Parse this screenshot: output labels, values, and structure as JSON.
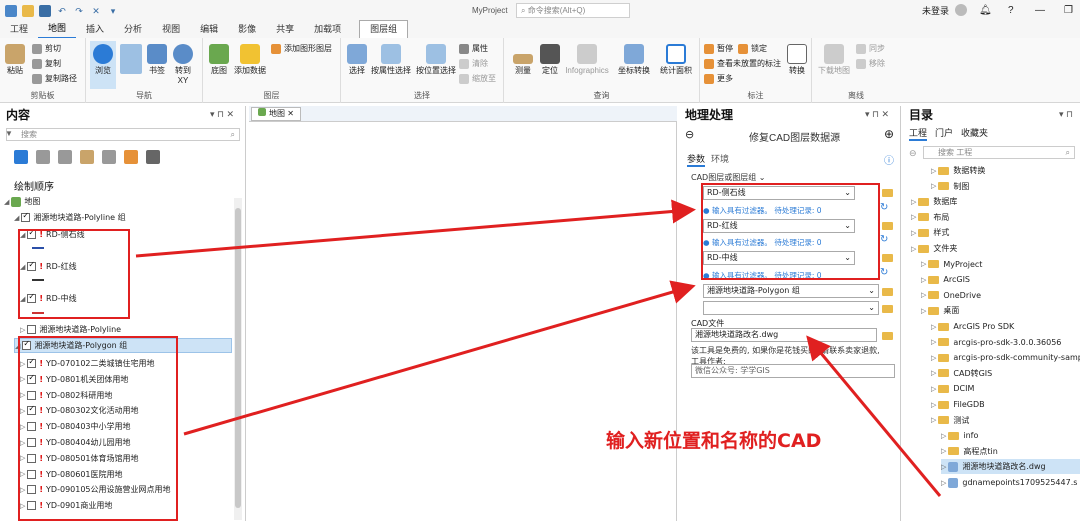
{
  "titlebar": {
    "project": "MyProject",
    "search_placeholder": "命令搜索(Alt+Q)",
    "login": "未登录",
    "help": "?"
  },
  "menu": {
    "tabs": [
      "工程",
      "地图",
      "插入",
      "分析",
      "视图",
      "编辑",
      "影像",
      "共享",
      "加载项"
    ],
    "context_tab": "图层组"
  },
  "ribbon": {
    "clipboard": {
      "paste": "粘贴",
      "cut": "剪切",
      "copy": "复制",
      "copy_path": "复制路径",
      "label": "剪贴板"
    },
    "navigate": {
      "explore": "浏览",
      "bookmark": "书签",
      "goto": "转到\nXY",
      "label": "导航"
    },
    "layer": {
      "basemap": "底图",
      "add_data": "添加数据",
      "add_graphics": "添加图形图层",
      "label": "图层"
    },
    "selection": {
      "select": "选择",
      "by_attr": "按属性选择",
      "by_loc": "按位置选择",
      "attr": "属性",
      "clear": "清除",
      "zoom": "缩放至",
      "label": "选择"
    },
    "inquiry": {
      "measure": "测量",
      "locate": "定位",
      "infographics": "Infographics",
      "coord": "坐标转换",
      "stats": "统计面积",
      "label": "查询"
    },
    "labeling": {
      "pause": "暂停",
      "lock": "锁定",
      "unplaced": "查看未放置的标注",
      "more": "更多",
      "convert": "转换",
      "label": "标注"
    },
    "offline": {
      "download": "下载地图",
      "sync": "同步",
      "remove": "移除",
      "label": "离线"
    }
  },
  "contents": {
    "title": "内容",
    "search_placeholder": "搜索",
    "draw_order": "绘制顺序",
    "map": "地图",
    "group1": "湘源地块道路-Polyline 组",
    "group1_items": [
      "RD-侧石线",
      "RD-红线",
      "RD-中线"
    ],
    "polyline": "湘源地块道路-Polyline",
    "group2": "湘源地块道路-Polygon 组",
    "group2_items": [
      "YD-070102二类城镇住宅用地",
      "YD-0801机关团体用地",
      "YD-0802科研用地",
      "YD-080302文化活动用地",
      "YD-080403中小学用地",
      "YD-080404幼儿园用地",
      "YD-080501体育场馆用地",
      "YD-080601医院用地",
      "YD-090105公用设施营业网点用地",
      "YD-0901商业用地"
    ]
  },
  "map": {
    "tab": "地图"
  },
  "geoprocessing": {
    "title": "地理处理",
    "tool": "修复CAD图层数据源",
    "tab_params": "参数",
    "tab_env": "环境",
    "input_label": "CAD图层或图层组",
    "inputs": [
      "RD-侧石线",
      "RD-红线",
      "RD-中线"
    ],
    "info_text": "输入具有过滤器。 待处理记录: 0",
    "group_input": "湘源地块道路-Polygon 组",
    "cad_label": "CAD文件",
    "cad_value": "湘源地块道路改名.dwg",
    "note": "该工具是免费的, 如果你是花钱买的, 请联系卖家退款, 工具作者:",
    "author": "微信公众号: 学学GIS"
  },
  "annotation": "输入新位置和名称的CAD",
  "catalog": {
    "title": "目录",
    "tabs": [
      "工程",
      "门户",
      "收藏夹"
    ],
    "search_placeholder": "搜索 工程",
    "items": [
      {
        "label": "数据转换",
        "indent": 2
      },
      {
        "label": "制图",
        "indent": 2
      },
      {
        "label": "数据库",
        "indent": 0
      },
      {
        "label": "布局",
        "indent": 0
      },
      {
        "label": "样式",
        "indent": 0
      },
      {
        "label": "文件夹",
        "indent": 0
      },
      {
        "label": "MyProject",
        "indent": 1
      },
      {
        "label": "ArcGIS",
        "indent": 1
      },
      {
        "label": "OneDrive",
        "indent": 1
      },
      {
        "label": "桌面",
        "indent": 1
      },
      {
        "label": "ArcGIS Pro SDK",
        "indent": 2
      },
      {
        "label": "arcgis-pro-sdk-3.0.0.36056",
        "indent": 2
      },
      {
        "label": "arcgis-pro-sdk-community-samp",
        "indent": 2
      },
      {
        "label": "CAD转GIS",
        "indent": 2
      },
      {
        "label": "DCIM",
        "indent": 2
      },
      {
        "label": "FileGDB",
        "indent": 2
      },
      {
        "label": "测试",
        "indent": 2
      },
      {
        "label": "info",
        "indent": 3
      },
      {
        "label": "高程点tin",
        "indent": 3
      },
      {
        "label": "湘源地块道路改名.dwg",
        "indent": 3
      },
      {
        "label": "gdnamepoints1709525447.s",
        "indent": 3
      }
    ]
  }
}
